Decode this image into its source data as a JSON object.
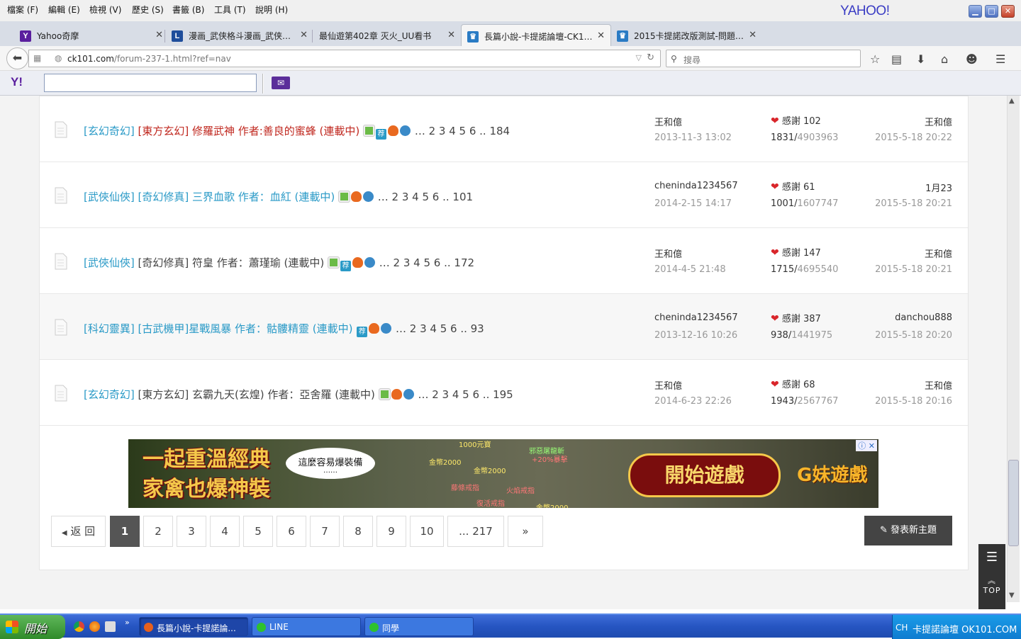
{
  "menubar": {
    "items": [
      "檔案 (F)",
      "編輯 (E)",
      "檢視 (V)",
      "歷史 (S)",
      "書籤 (B)",
      "工具 (T)",
      "說明 (H)"
    ],
    "brand": "YAHOO!"
  },
  "tabs": [
    {
      "label": "Yahoo奇摩",
      "icon": "yahoo-icon",
      "color": "#5a1e9e"
    },
    {
      "label": "漫画_武侠格斗漫画_武侠…",
      "icon": "comic-site-icon",
      "color": "#1e4d9b"
    },
    {
      "label": "最仙遊第402章 灭火_UU看书",
      "icon": "",
      "color": ""
    },
    {
      "label": "長篇小說-卡提諾論壇-CK1…",
      "icon": "ck101-icon",
      "color": "#2a7bc4",
      "active": true
    },
    {
      "label": "2015卡提諾改版測試-問題…",
      "icon": "ck101-icon",
      "color": "#2a7bc4"
    }
  ],
  "navbar": {
    "url_host": "ck101.com",
    "url_path": "/forum-237-1.html?ref=nav",
    "search_placeholder": "搜尋"
  },
  "threads": [
    {
      "segments": [
        {
          "text": "[玄幻奇幻]",
          "cls": "cat"
        },
        {
          "text": " [東方玄幻] 修羅武神 作者:善良的蜜蜂 (連載中)",
          "cls": "red"
        }
      ],
      "icons": [
        "img",
        "rec",
        "hot",
        "plus"
      ],
      "pages": "… 2 3 4 5 6 .. 184",
      "author": "王和億",
      "date": "2013-11-3 13:02",
      "thanks": "感謝 102",
      "replies": "1831",
      "views": "4903963",
      "last_user": "王和億",
      "last_date": "2015-5-18 20:22"
    },
    {
      "segments": [
        {
          "text": "[武俠仙俠]",
          "cls": "cat"
        },
        {
          "text": " [奇幻修真] 三界血歌 作者：血紅 (連載中)",
          "cls": "bl"
        }
      ],
      "icons": [
        "img",
        "hot",
        "plus"
      ],
      "pages": "… 2 3 4 5 6 .. 101",
      "author": "cheninda1234567",
      "date": "2014-2-15 14:17",
      "thanks": "感謝 61",
      "replies": "1001",
      "views": "1607747",
      "last_user": "1月23",
      "last_date": "2015-5-18 20:21"
    },
    {
      "segments": [
        {
          "text": "[武俠仙俠]",
          "cls": "cat"
        },
        {
          "text": " [奇幻修真] 符皇 作者：蕭瑾瑜 (連載中)",
          "cls": "pg"
        }
      ],
      "icons": [
        "img",
        "rec",
        "hot",
        "plus"
      ],
      "pages": "… 2 3 4 5 6 .. 172",
      "author": "王和億",
      "date": "2014-4-5 21:48",
      "thanks": "感謝 147",
      "replies": "1715",
      "views": "4695540",
      "last_user": "王和億",
      "last_date": "2015-5-18 20:21"
    },
    {
      "segments": [
        {
          "text": "[科幻靈異]",
          "cls": "cat"
        },
        {
          "text": " [古武機甲]星戰風暴 作者：骷髏精靈 (連載中)",
          "cls": "bl"
        }
      ],
      "icons": [
        "rec",
        "hot",
        "plus"
      ],
      "pages": "… 2 3 4 5 6 .. 93",
      "author": "cheninda1234567",
      "date": "2013-12-16 10:26",
      "thanks": "感謝 387",
      "replies": "938",
      "views": "1441975",
      "last_user": "danchou888",
      "last_date": "2015-5-18 20:20",
      "highlight": true
    },
    {
      "segments": [
        {
          "text": "[玄幻奇幻]",
          "cls": "cat"
        },
        {
          "text": " [東方玄幻] 玄霸九天(玄煌) 作者：亞舍羅 (連載中)",
          "cls": "pg"
        }
      ],
      "icons": [
        "img",
        "hot",
        "plus"
      ],
      "pages": "… 2 3 4 5 6 .. 195",
      "author": "王和億",
      "date": "2014-6-23 22:26",
      "thanks": "感謝 68",
      "replies": "1943",
      "views": "2567767",
      "last_user": "王和億",
      "last_date": "2015-5-18 20:16"
    }
  ],
  "ad": {
    "headline_1": "一起重溫經典",
    "headline_2": "家禽也爆神裝",
    "bubble": "這麼容易爆裝備",
    "bubble_dots": "……",
    "labels": [
      "1000元寶",
      "金幣2000",
      "金幣2000",
      "邪惡屠龍斬",
      "+20%暴擊",
      "藤條戒指",
      "火焰戒指",
      "復活戒指",
      "金幣2000"
    ],
    "button": "開始遊戲",
    "brand": "G妹遊戲"
  },
  "pager": {
    "back": "返 回",
    "pages": [
      "1",
      "2",
      "3",
      "4",
      "5",
      "6",
      "7",
      "8",
      "9",
      "10",
      "... 217"
    ],
    "next": "»",
    "current": "1",
    "new_post": "發表新主題"
  },
  "float_menu": {
    "top": "TOP"
  },
  "taskbar": {
    "start": "開始",
    "tasks": [
      {
        "label": "長篇小說-卡提諾論...",
        "color": "#e8601c",
        "active": true
      },
      {
        "label": "LINE",
        "color": "#2ec22e"
      },
      {
        "label": "同學",
        "color": "#2ec22e"
      }
    ],
    "lang": "CH",
    "tray_text": "卡提諾論壇 OK101.COM"
  }
}
